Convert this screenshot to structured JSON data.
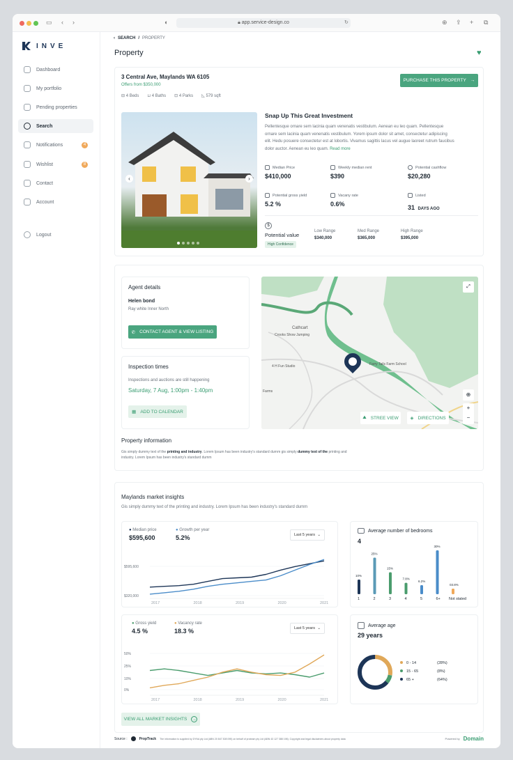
{
  "browser": {
    "url": "app.service-design.co"
  },
  "brand": {
    "name": "INVE"
  },
  "sidebar": {
    "items": [
      {
        "label": "Dashboard",
        "icon": "dashboard-icon"
      },
      {
        "label": "My portfolio",
        "icon": "portfolio-icon"
      },
      {
        "label": "Pending properties",
        "icon": "pending-icon"
      },
      {
        "label": "Search",
        "icon": "search-icon",
        "active": true
      },
      {
        "label": "Notifications",
        "icon": "bell-icon",
        "badge": "4"
      },
      {
        "label": "Wishlist",
        "icon": "heart-icon",
        "badge": "8"
      },
      {
        "label": "Contact",
        "icon": "chat-icon"
      },
      {
        "label": "Account",
        "icon": "user-icon"
      }
    ],
    "logout": "Logout"
  },
  "breadcrumb": {
    "search": "SEARCH",
    "sep": "/",
    "current": "PROPERTY"
  },
  "page": {
    "title": "Property"
  },
  "property": {
    "address": "3 Central Ave, Maylands WA 6105",
    "offers": "Offers from $350,000",
    "beds": "4 Beds",
    "baths": "4 Baths",
    "parks": "4 Parks",
    "area": "579 sqft",
    "purchase_label": "PURCHASE THIS PROPERTY",
    "headline": "Snap Up This Great Investment",
    "description": "Pellentesque ornare sem lacinia quam venenatis vestibulum. Aenean eu leo quam. Pellentesque ornare sem lacinia quam venenatis vestibulum. Yorem ipsum dolor sit amet, consectetur adipiscing elit. Hedu posuere consectetur est at lobortis. Vivamus sagittis lacus vel augue laoreet rutrum faucibus dolor auctor. Aenean eu leo quam.",
    "read_more": "Read more",
    "carousel_dots": 5,
    "carousel_active": 0
  },
  "stats": {
    "median_price_label": "Median Price",
    "median_price": "$410,000",
    "weekly_rent_label": "Weekly median rent",
    "weekly_rent": "$390",
    "cashflow_label": "Potential cashflow",
    "cashflow": "$20,280",
    "gross_yield_label": "Potential gross yield",
    "gross_yield": "5.2 %",
    "vacancy_label": "Vacany rate",
    "vacancy": "0.6%",
    "listed_label": "Listed",
    "listed_days": "31",
    "listed_unit": "DAYS AGO"
  },
  "valuation": {
    "label": "Potential value",
    "confidence": "High Confidence",
    "low_label": "Low Range",
    "low": "$340,000",
    "mid_label": "Med Range",
    "mid": "$365,000",
    "high_label": "High Range",
    "high": "$395,000"
  },
  "agent": {
    "section": "Agent details",
    "name": "Helen bond",
    "agency": "Ray white Inner North",
    "contact_label": "CONTACT AGENT & VIEW LISTING"
  },
  "inspection": {
    "section": "Inspection times",
    "note": "Inspections and auctions are still happening",
    "time": "Saturday, 7 Aug, 1:00pm - 1:40pm",
    "calendar_label": "ADD TO CALENDAR"
  },
  "map": {
    "labels": [
      "Cathcart",
      "Crooks Show Jumping",
      "Farry Tails Farm School",
      "4 H Fun Studio",
      "Farms"
    ],
    "street_view": "STREE VIEW",
    "directions": "DIRECTIONS"
  },
  "info": {
    "title": "Property information",
    "p1a": "Gis simply dummy text of the ",
    "p1b": "printing and industry",
    "p1c": ". Lorem Ipsum has been industry's standard durnm gis simply ",
    "p1d": "dummy text of the",
    "p2": "printing and industry. Lorem Ipsum has been industry's standard dumm"
  },
  "insights": {
    "title": "Maylands market insights",
    "subtitle": "Gis simply dummy text of the printing and industry. Lorem Ipsum has been industry's standard dumm",
    "view_all": "VIEW ALL MARKET INSIGHTS"
  },
  "colors": {
    "accent": "#4aa57f",
    "navy": "#1d3557",
    "blue": "#4a8cc9",
    "teal": "#5a9ab6",
    "orange": "#e0a859",
    "green": "#4a9c6d"
  },
  "chart_data": [
    {
      "type": "line",
      "legend": [
        "Median price",
        "Growth per year"
      ],
      "values": [
        "$595,600",
        "5.2%"
      ],
      "period": "Last 5 years",
      "x": [
        "2017",
        "2018",
        "2019",
        "2020",
        "2021"
      ],
      "y_ticks": [
        "$595,600",
        "$320,000"
      ],
      "series": [
        {
          "name": "Median price",
          "values": [
            380,
            385,
            390,
            400,
            420,
            440,
            445,
            450,
            470,
            500,
            525,
            545,
            565
          ]
        },
        {
          "name": "Growth per year",
          "values": [
            330,
            340,
            350,
            365,
            385,
            400,
            410,
            420,
            430,
            460,
            500,
            540,
            575
          ]
        }
      ],
      "x_points": 13
    },
    {
      "type": "bar",
      "title": "Average number of bedrooms",
      "value": "4",
      "categories": [
        "1",
        "2",
        "3",
        "4",
        "5",
        "6+",
        "Not stated"
      ],
      "values": [
        10,
        25,
        15,
        7.8,
        6.2,
        30,
        3.8
      ],
      "labels": [
        "10%",
        "25%",
        "15%",
        "7.8%",
        "6.2%",
        "30%",
        "03.8%"
      ]
    },
    {
      "type": "line",
      "legend": [
        "Gross yield",
        "Vacancy rate"
      ],
      "values": [
        "4.5 %",
        "18.3 %"
      ],
      "period": "Last 5 years",
      "x": [
        "2017",
        "2018",
        "2019",
        "2020",
        "2021"
      ],
      "y_ticks": [
        "50%",
        "25%",
        "10%",
        "0%"
      ],
      "series": [
        {
          "name": "Gross yield",
          "values": [
            30,
            32,
            30,
            27,
            24,
            27,
            30,
            27,
            26,
            27,
            25,
            22,
            27
          ]
        },
        {
          "name": "Vacancy rate",
          "values": [
            9,
            12,
            14,
            18,
            22,
            28,
            32,
            28,
            25,
            24,
            28,
            38,
            49
          ]
        }
      ],
      "x_points": 13
    },
    {
      "type": "pie",
      "title": "Average age",
      "value": "29 years",
      "categories": [
        "0 - 14",
        "15 - 65",
        "65 +"
      ],
      "values": [
        28,
        8,
        64
      ],
      "labels": [
        "(28%)",
        "(8%)",
        "(64%)"
      ]
    }
  ],
  "footer": {
    "source": "Source :",
    "propstack": "PropTrack",
    "disclaimer": "The information is supplied by DYNA pty Ltd (ABN 20 847 308 095) on behalf of proteam pty Ltd (ABN 43 127 388 198). Copyright and legal disclaimers about property data",
    "powered": "Powered by",
    "domain": "Domain"
  }
}
